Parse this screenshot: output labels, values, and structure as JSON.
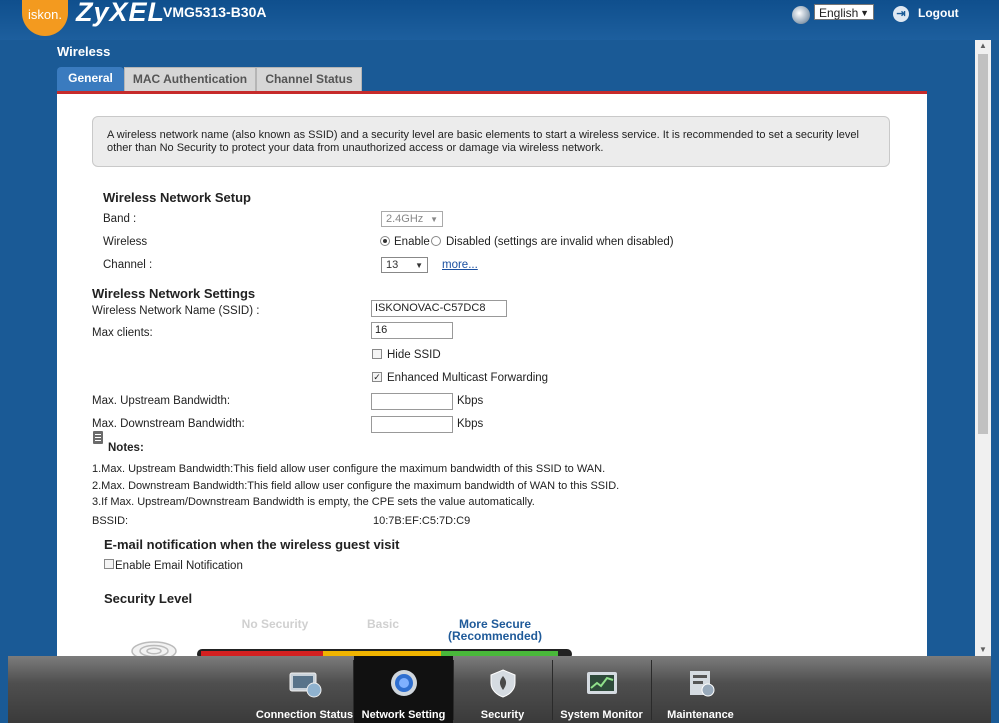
{
  "header": {
    "brand_small": "iskon.",
    "brand": "ZyXEL",
    "model": "VMG5313-B30A",
    "language": "English",
    "logout": "Logout"
  },
  "page": {
    "title": "Wireless",
    "tabs": [
      {
        "label": "General",
        "active": true
      },
      {
        "label": "MAC Authentication",
        "active": false
      },
      {
        "label": "Channel Status",
        "active": false
      }
    ]
  },
  "info_text": "A wireless network name (also known as SSID) and a security level are basic elements to start a wireless service. It is recommended to set a security level other than No Security to protect your data from unauthorized access or damage via wireless network.",
  "setup": {
    "heading": "Wireless Network Setup",
    "band_label": "Band :",
    "band_value": "2.4GHz",
    "wireless_label": "Wireless",
    "enable_label": "Enable",
    "disabled_label": "Disabled (settings are invalid when disabled)",
    "channel_label": "Channel :",
    "channel_value": "13",
    "more_link": "more..."
  },
  "settings": {
    "heading": "Wireless Network Settings",
    "ssid_label": "Wireless Network Name (SSID) :",
    "ssid_value": "ISKONOVAC-C57DC8",
    "max_clients_label": "Max clients:",
    "max_clients_value": "16",
    "hide_ssid": "Hide SSID",
    "multicast": "Enhanced Multicast Forwarding",
    "upstream_label": "Max. Upstream Bandwidth:",
    "downstream_label": "Max. Downstream Bandwidth:",
    "unit": "Kbps"
  },
  "notes": {
    "title": "Notes:",
    "items": [
      "1.Max. Upstream Bandwidth:This field allow user configure the maximum bandwidth of this SSID to WAN.",
      "2.Max. Downstream Bandwidth:This field allow user configure the maximum bandwidth of WAN to this SSID.",
      "3.If Max. Upstream/Downstream Bandwidth is empty, the CPE sets the value automatically."
    ]
  },
  "bssid": {
    "label": "BSSID:",
    "value": "10:7B:EF:C5:7D:C9"
  },
  "email": {
    "heading": "E-mail notification when the wireless guest visit",
    "enable_label": "Enable Email Notification"
  },
  "security": {
    "heading": "Security Level",
    "levels": [
      "No Security",
      "Basic",
      "More Secure",
      "(Recommended)"
    ]
  },
  "nav": [
    {
      "label": "Connection Status",
      "active": false
    },
    {
      "label": "Network Setting",
      "active": true
    },
    {
      "label": "Security",
      "active": false
    },
    {
      "label": "System Monitor",
      "active": false
    },
    {
      "label": "Maintenance",
      "active": false
    }
  ],
  "colors": {
    "header_blue": "#1a5a96",
    "tab_active": "#3a7bbf",
    "accent_red": "#c62b2b",
    "bar_red": "#d42020",
    "bar_yellow": "#f0b400",
    "bar_green": "#49b83a",
    "logo_orange": "#f39a1f"
  }
}
